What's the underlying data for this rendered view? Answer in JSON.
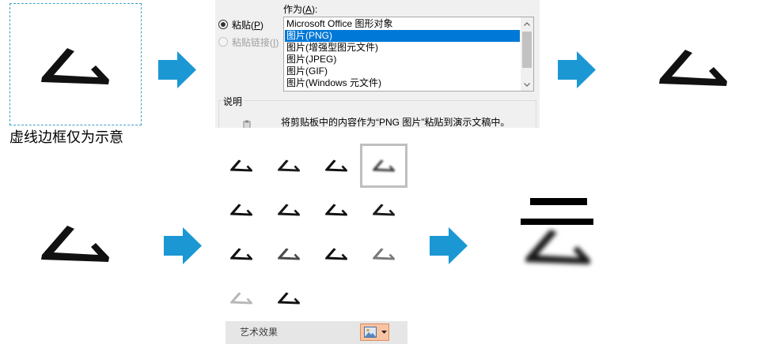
{
  "caption": "虚线边框仅为示意",
  "colors": {
    "arrow": "#1b98d4",
    "dashed_border": "#3d9fc8",
    "list_selection": "#0078d7",
    "button_highlight": "#f8c4a4",
    "glyph": "#111111"
  },
  "icons": {
    "arrow": "arrow-right-icon",
    "scroll_up": "chevron-up-icon",
    "scroll_down": "chevron-down-icon",
    "description": "clipboard-icon",
    "effect_button": "picture-icon",
    "dropdown": "caret-down-icon"
  },
  "paste_dialog": {
    "paste_option": {
      "label": "粘贴(P)",
      "checked": true,
      "enabled": true
    },
    "paste_link_option": {
      "label": "粘贴链接(I)",
      "checked": false,
      "enabled": false
    },
    "as_label": "作为(A):",
    "as_options": [
      "Microsoft Office 图形对象",
      "图片(PNG)",
      "图片(增强型图元文件)",
      "图片(JPEG)",
      "图片(GIF)",
      "图片(Windows 元文件)"
    ],
    "selected_option_index": 1,
    "description_label": "说明",
    "description_text": "将剪贴板中的内容作为“PNG 图片”粘贴到演示文稿中。"
  },
  "art_effects": {
    "label": "艺术效果",
    "selected_index": 3,
    "thumbnails": [
      {
        "color": "#111111",
        "blurred": false
      },
      {
        "color": "#1a1a1a",
        "blurred": false
      },
      {
        "color": "#111111",
        "blurred": false
      },
      {
        "color": "#3a3a3a",
        "blurred": true
      },
      {
        "color": "#111111",
        "blurred": false
      },
      {
        "color": "#161616",
        "blurred": false
      },
      {
        "color": "#111111",
        "blurred": false
      },
      {
        "color": "#1c1c1c",
        "blurred": false
      },
      {
        "color": "#111111",
        "blurred": false
      },
      {
        "color": "#4a4a4a",
        "blurred": false
      },
      {
        "color": "#111111",
        "blurred": false
      },
      {
        "color": "#7a7a7a",
        "blurred": false
      },
      {
        "color": "#b8b8b8",
        "blurred": false
      },
      {
        "color": "#111111",
        "blurred": false
      }
    ]
  }
}
